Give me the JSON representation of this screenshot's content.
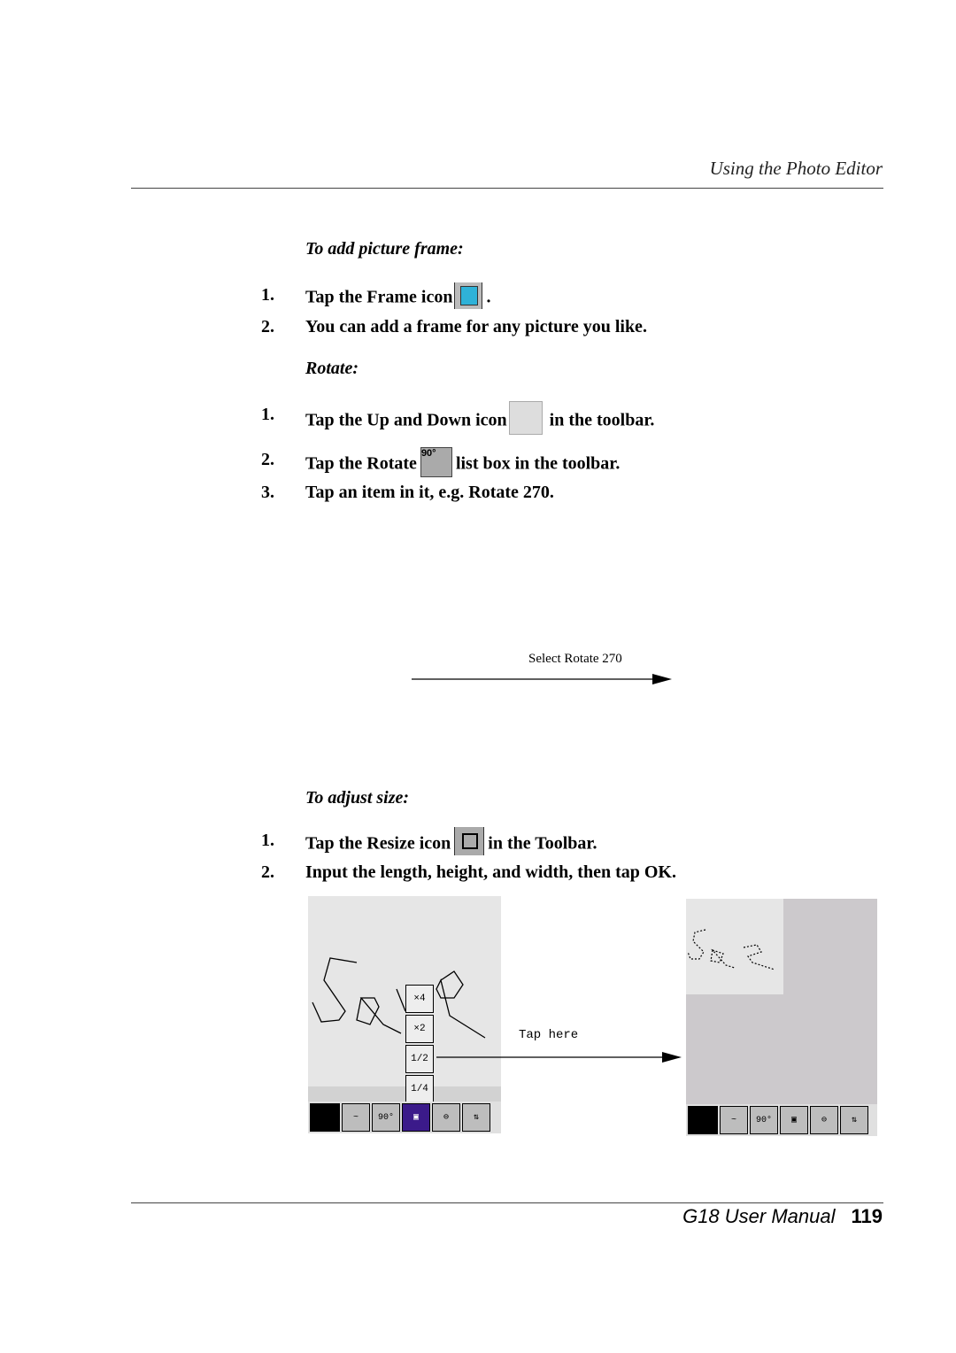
{
  "header": {
    "title": "Using the Photo Editor"
  },
  "section_frame": {
    "heading": "To add picture frame:",
    "steps": [
      {
        "num": "1.",
        "before": "Tap the Frame icon",
        "after": ".",
        "icon": "frame-icon"
      },
      {
        "num": "2.",
        "text": "You can add a frame for any picture you like."
      }
    ]
  },
  "section_rotate": {
    "heading": "Rotate:",
    "steps": [
      {
        "num": "1.",
        "before": "Tap the Up and Down icon",
        "after": "in the toolbar.",
        "icon": "up-down-icon"
      },
      {
        "num": "2.",
        "before": "Tap the Rotate",
        "after": "list box in the toolbar.",
        "icon": "rotate-icon",
        "icon_label": "90°"
      },
      {
        "num": "3.",
        "text": "Tap an item in it, e.g. Rotate 270."
      }
    ],
    "callout": "Select Rotate  270"
  },
  "section_resize": {
    "heading": "To adjust size:",
    "steps": [
      {
        "num": "1.",
        "before": "Tap the Resize icon",
        "after": "in the Toolbar.",
        "icon": "resize-icon"
      },
      {
        "num": "2.",
        "text": "Input the length, height, and width, then tap OK."
      }
    ],
    "callout": "Tap here",
    "zoom_options": [
      "×4",
      "×2",
      "1/2",
      "1/4"
    ],
    "toolbar": {
      "rotate_label": "90°"
    }
  },
  "footer": {
    "manual": "G18 User Manual",
    "page": "119"
  }
}
